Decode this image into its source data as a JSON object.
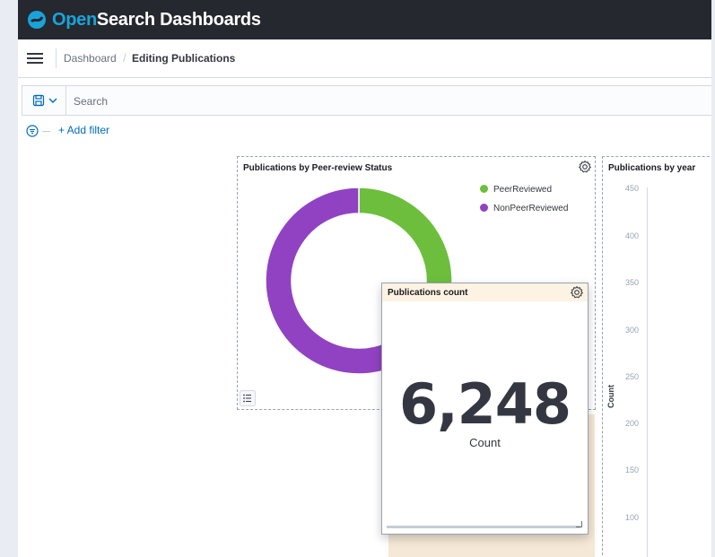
{
  "header": {
    "brand_open": "Open",
    "brand_rest": "Search Dashboards"
  },
  "breadcrumbs": {
    "root": "Dashboard",
    "separator": "/",
    "current": "Editing Publications"
  },
  "query": {
    "placeholder": "Search",
    "value": ""
  },
  "filters": {
    "add_label": "+ Add filter"
  },
  "panels": {
    "peer_review": {
      "title": "Publications by Peer-review Status",
      "legend": [
        {
          "label": "PeerReviewed",
          "color": "#6dbe3d"
        },
        {
          "label": "NonPeerReviewed",
          "color": "#9142c2"
        }
      ]
    },
    "count": {
      "title": "Publications count",
      "value": "6,248",
      "label": "Count"
    },
    "by_year": {
      "title": "Publications by year",
      "y_axis_label": "Count",
      "y_ticks": [
        "450",
        "400",
        "350",
        "300",
        "250",
        "200",
        "150",
        "100"
      ]
    }
  },
  "colors": {
    "accent": "#006bb8",
    "header_bg": "#25282f",
    "peer_reviewed": "#6dbe3d",
    "non_peer_reviewed": "#9142c2"
  },
  "chart_data": {
    "type": "pie",
    "categories": [
      "PeerReviewed",
      "NonPeerReviewed"
    ],
    "values": [
      36,
      64
    ]
  }
}
